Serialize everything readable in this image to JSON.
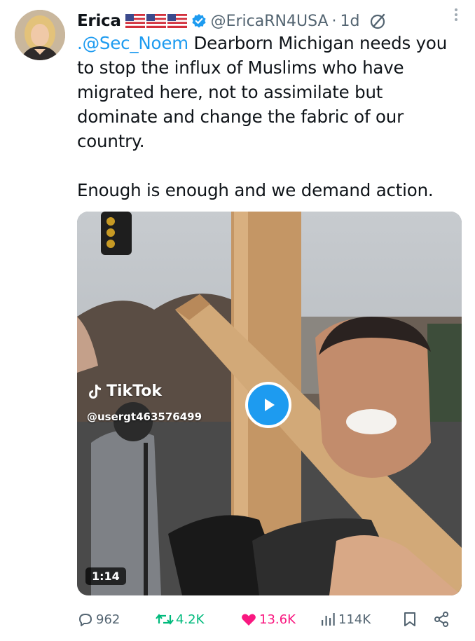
{
  "author": {
    "name": "Erica",
    "handle": "@EricaRN4USA",
    "separator": "·",
    "time": "1d",
    "flag_count": 3,
    "verified": true
  },
  "tweet": {
    "mention": ".@Sec_Noem",
    "line1_rest": " Dearborn Michigan needs you to stop the influx of Muslims who have migrated here, not to assimilate but dominate and change the fabric of our country.",
    "paragraph2": "Enough is enough and we demand action."
  },
  "media": {
    "watermark_brand": "TikTok",
    "watermark_user": "@usergt463576499",
    "duration": "1:14"
  },
  "actions": {
    "replies": "962",
    "reposts": "4.2K",
    "likes": "13.6K",
    "views": "114K"
  },
  "colors": {
    "accent": "#1d9bf0",
    "repost": "#00ba7c",
    "like": "#f91880",
    "muted": "#536471"
  },
  "icons": [
    "verified-badge-icon",
    "grok-icon",
    "more-icon",
    "tiktok-logo-icon",
    "play-icon",
    "reply-icon",
    "repost-icon",
    "like-icon",
    "views-icon",
    "bookmark-icon",
    "share-icon"
  ]
}
